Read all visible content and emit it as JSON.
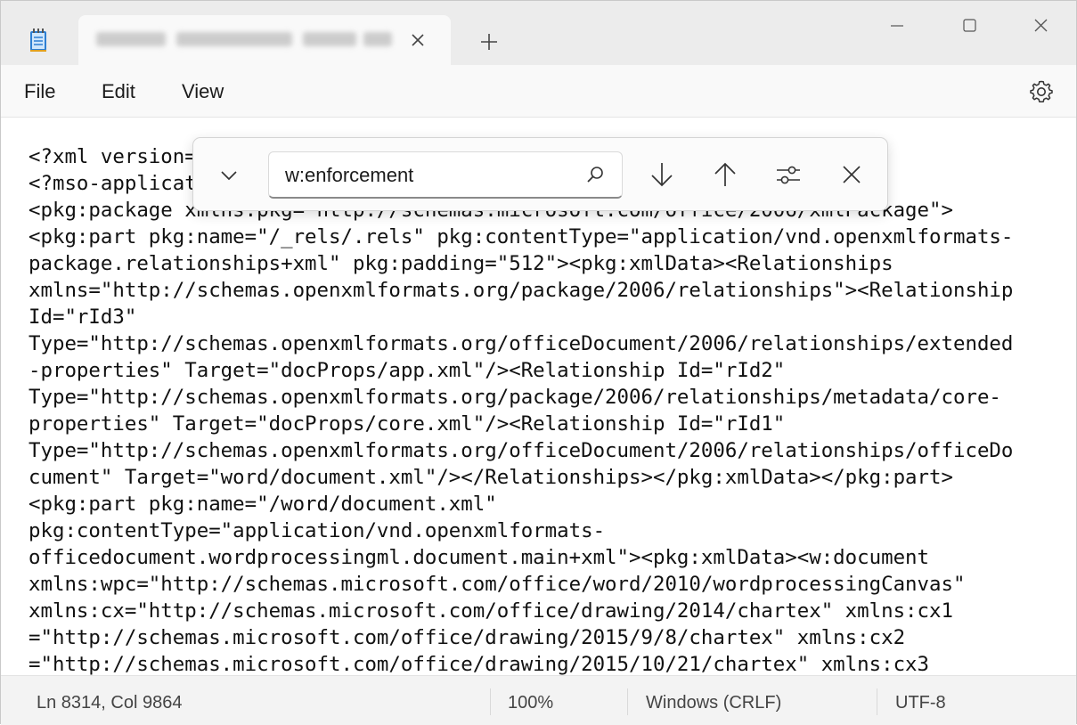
{
  "tab": {
    "title": ""
  },
  "menu": {
    "file": "File",
    "edit": "Edit",
    "view": "View"
  },
  "find": {
    "query": "w:enforcement"
  },
  "editor": {
    "lines": [
      "<?xml version=",
      "<?mso-applicat",
      "<pkg:package xmlns:pkg=\"http://schemas.microsoft.com/office/2006/xmlPackage\">",
      "<pkg:part pkg:name=\"/_rels/.rels\" pkg:contentType=\"application/vnd.openxmlformats-",
      "package.relationships+xml\" pkg:padding=\"512\"><pkg:xmlData><Relationships",
      "xmlns=\"http://schemas.openxmlformats.org/package/2006/relationships\"><Relationship",
      "Id=\"rId3\"",
      "Type=\"http://schemas.openxmlformats.org/officeDocument/2006/relationships/extended",
      "-properties\" Target=\"docProps/app.xml\"/><Relationship Id=\"rId2\"",
      "Type=\"http://schemas.openxmlformats.org/package/2006/relationships/metadata/core-",
      "properties\" Target=\"docProps/core.xml\"/><Relationship Id=\"rId1\"",
      "Type=\"http://schemas.openxmlformats.org/officeDocument/2006/relationships/officeDo",
      "cument\" Target=\"word/document.xml\"/></Relationships></pkg:xmlData></pkg:part>",
      "<pkg:part pkg:name=\"/word/document.xml\"",
      "pkg:contentType=\"application/vnd.openxmlformats-",
      "officedocument.wordprocessingml.document.main+xml\"><pkg:xmlData><w:document",
      "xmlns:wpc=\"http://schemas.microsoft.com/office/word/2010/wordprocessingCanvas\"",
      "xmlns:cx=\"http://schemas.microsoft.com/office/drawing/2014/chartex\" xmlns:cx1",
      "=\"http://schemas.microsoft.com/office/drawing/2015/9/8/chartex\" xmlns:cx2",
      "=\"http://schemas.microsoft.com/office/drawing/2015/10/21/chartex\" xmlns:cx3"
    ]
  },
  "status": {
    "position": "Ln 8314, Col 9864",
    "zoom": "100%",
    "line_ending": "Windows (CRLF)",
    "encoding": "UTF-8"
  },
  "icons": {
    "app": "notepad-icon",
    "tab_close": "close-icon",
    "new_tab": "plus-icon",
    "minimize": "minimize-icon",
    "maximize": "maximize-icon",
    "close": "close-icon",
    "settings": "gear-icon",
    "find_toggle": "chevron-down-icon",
    "find_search": "search-icon",
    "find_next": "arrow-down-icon",
    "find_prev": "arrow-up-icon",
    "find_options": "sliders-icon",
    "find_close": "close-icon"
  }
}
